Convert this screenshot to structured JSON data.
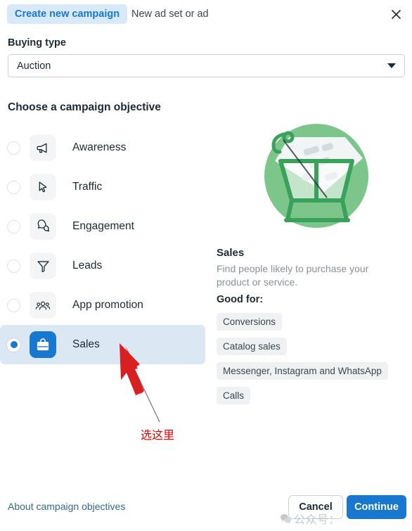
{
  "window": {
    "tabs": [
      {
        "label": "Create new campaign",
        "active": true,
        "name": "tab-create-new-campaign"
      },
      {
        "label": "New ad set or ad",
        "active": false,
        "name": "tab-new-ad-set-or-ad"
      }
    ],
    "close_icon": "close-icon"
  },
  "buying_type": {
    "label": "Buying type",
    "selected_value": "Auction",
    "caret_icon": "chevron-down-icon"
  },
  "objectives": {
    "heading": "Choose a campaign objective",
    "items": [
      {
        "label": "Awareness",
        "icon": "megaphone-icon",
        "selected": false
      },
      {
        "label": "Traffic",
        "icon": "cursor-arrow-icon",
        "selected": false
      },
      {
        "label": "Engagement",
        "icon": "speech-bubbles-icon",
        "selected": false
      },
      {
        "label": "Leads",
        "icon": "funnel-icon",
        "selected": false
      },
      {
        "label": "App promotion",
        "icon": "people-group-icon",
        "selected": false
      },
      {
        "label": "Sales",
        "icon": "shopping-bag-icon",
        "selected": true
      }
    ]
  },
  "detail": {
    "illustration": "shopping-cart-price-tag-illustration",
    "title": "Sales",
    "description": "Find people likely to purchase your product or service.",
    "good_for_label": "Good for:",
    "tags": [
      "Conversions",
      "Catalog sales",
      "Messenger, Instagram and WhatsApp",
      "Calls"
    ]
  },
  "annotation": {
    "text": "选这里",
    "color": "#e60000",
    "arrow_icon": "red-arrow-icon"
  },
  "footer": {
    "link": "About campaign objectives",
    "cancel_label": "Cancel",
    "continue_label": "Continue"
  },
  "watermark": {
    "text": "公众号：",
    "logo_icon": "wechat-logo-icon"
  },
  "colors": {
    "accent_blue": "#1878d0",
    "tab_active_bg": "#d8e9f9",
    "selected_row_bg": "#dbe7f2",
    "tag_bg": "#eff1f3",
    "illustration_green": "#7cc68c",
    "annotation_red": "#e60000"
  }
}
